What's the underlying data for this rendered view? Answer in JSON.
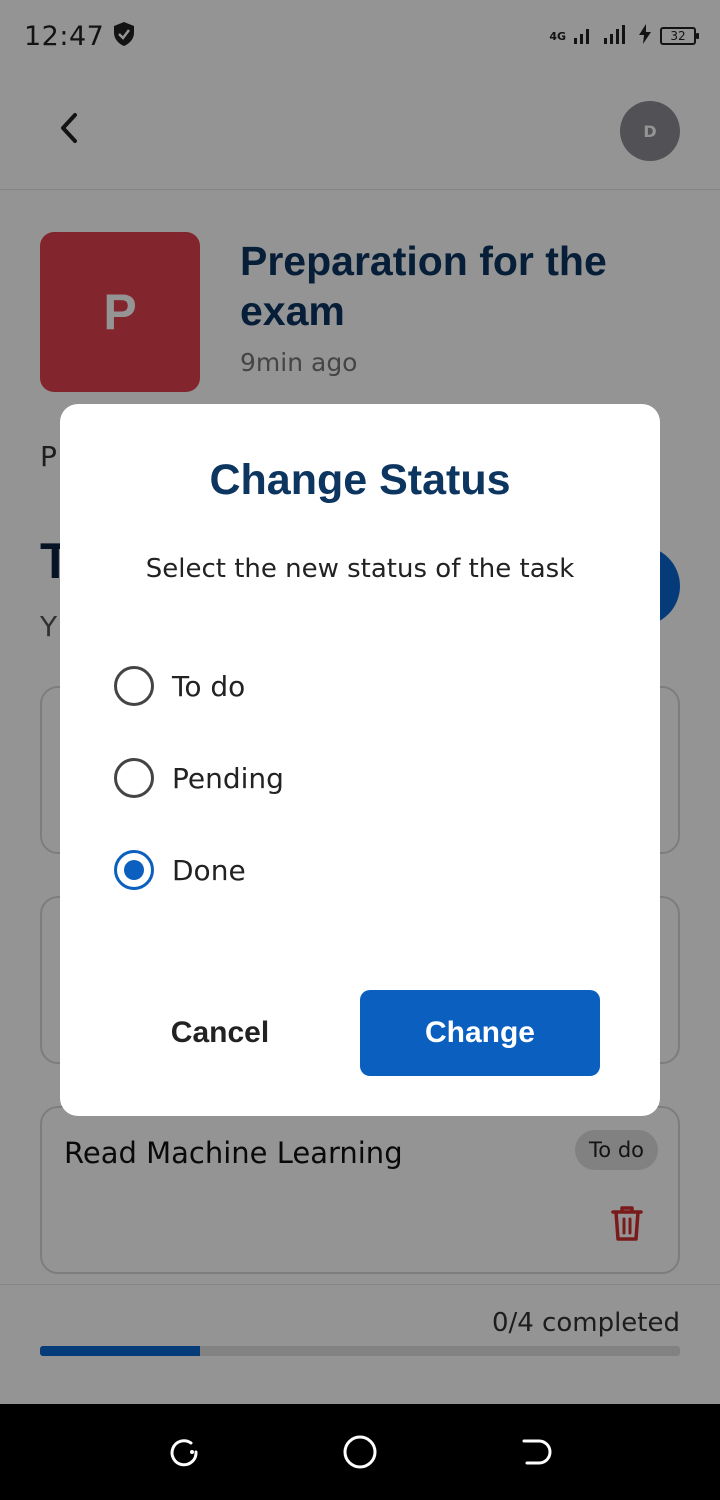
{
  "status_bar": {
    "time": "12:47",
    "network_label": "4G",
    "battery": "32",
    "icons": [
      "shield-icon",
      "signal-icon",
      "charging-icon",
      "battery-icon"
    ]
  },
  "header": {
    "avatar_initial": "D",
    "icons": [
      "back-arrow-icon"
    ]
  },
  "project": {
    "initial": "P",
    "title": "Preparation for the exam",
    "time_ago": "9min ago",
    "thumb_color": "#e2414c"
  },
  "background_fragments": {
    "description_initial": "P",
    "tasks_title_initial": "T",
    "tasks_sub_initial": "Y"
  },
  "tasks": [
    {
      "title": "Read Machine Learning",
      "status": "To do"
    }
  ],
  "progress": {
    "label": "0/4 completed",
    "fill_fraction": 0.25
  },
  "dialog": {
    "title": "Change Status",
    "subtitle": "Select the new status of the task",
    "options": [
      {
        "label": "To do",
        "selected": false
      },
      {
        "label": "Pending",
        "selected": false
      },
      {
        "label": "Done",
        "selected": true
      }
    ],
    "cancel_label": "Cancel",
    "confirm_label": "Change"
  },
  "colors": {
    "accent": "#0a5fbf",
    "title": "#0c3560",
    "delete": "#d32f2f"
  },
  "nav_bar": {
    "icons": [
      "recents-icon",
      "home-icon",
      "back-icon"
    ]
  }
}
